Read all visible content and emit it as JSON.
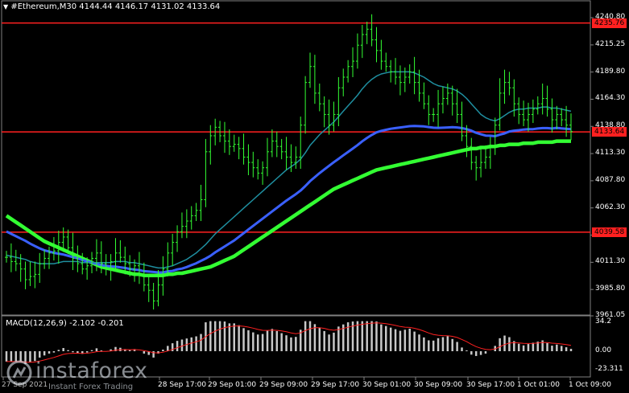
{
  "header": {
    "symbol_info": "#Ethereum,M30  4144.44 4146.17 4131.02 4133.64"
  },
  "price_axis": {
    "labels": [
      "4240.80",
      "4215.25",
      "4189.80",
      "4164.30",
      "4138.80",
      "4113.30",
      "4087.80",
      "4062.30",
      "4036.80",
      "4011.30",
      "3985.80",
      "3961.05"
    ],
    "tags": [
      {
        "text": "4235.76",
        "color": "#ff2020"
      },
      {
        "text": "4133.64",
        "color": "#ff2020"
      },
      {
        "text": "4039.58",
        "color": "#ff2020"
      }
    ]
  },
  "macd": {
    "label": "MACD(12,26,9) -2.102 -0.201",
    "axis_labels": [
      "34.2",
      "0.00",
      "-23.311"
    ]
  },
  "time_axis": {
    "labels": [
      "27 Sep 2021",
      "28 Sep 17:00",
      "29 Sep 01:00",
      "29 Sep 09:00",
      "29 Sep 17:00",
      "30 Sep 01:00",
      "30 Sep 09:00",
      "30 Sep 17:00",
      "1 Oct 01:00",
      "1 Oct 09:00"
    ]
  },
  "watermark": {
    "name": "instaforex",
    "tagline": "Instant Forex Trading"
  },
  "chart_data": {
    "type": "line",
    "symbol": "#Ethereum",
    "timeframe": "M30",
    "ylim": [
      3961.05,
      4240.8
    ],
    "horizontal_levels": [
      4235.76,
      4133.64,
      4039.58
    ],
    "colors": {
      "candle": "#33ff33",
      "ma_fast": "#1f8fa0",
      "ma_mid": "#3a60ff",
      "ma_slow": "#33ff33",
      "level": "#ff2020",
      "macd_hist": "#c8c8c8",
      "macd_signal": "#ff2020"
    },
    "close": [
      4016,
      4012,
      4010,
      4005,
      3995,
      3998,
      4000,
      4010,
      4015,
      4020,
      4022,
      4030,
      4035,
      4025,
      4015,
      4010,
      4005,
      4008,
      4015,
      4020,
      4010,
      4005,
      4012,
      4020,
      4016,
      4010,
      4005,
      4008,
      4000,
      3990,
      3985,
      3975,
      3990,
      4005,
      4020,
      4030,
      4040,
      4045,
      4050,
      4055,
      4060,
      4070,
      4115,
      4130,
      4138,
      4130,
      4125,
      4120,
      4122,
      4118,
      4110,
      4105,
      4100,
      4095,
      4100,
      4115,
      4125,
      4120,
      4115,
      4110,
      4105,
      4110,
      4140,
      4180,
      4195,
      4170,
      4160,
      4150,
      4140,
      4150,
      4175,
      4185,
      4195,
      4200,
      4215,
      4225,
      4230,
      4220,
      4210,
      4200,
      4195,
      4190,
      4185,
      4180,
      4185,
      4190,
      4180,
      4170,
      4160,
      4150,
      4150,
      4160,
      4165,
      4170,
      4160,
      4150,
      4130,
      4120,
      4105,
      4100,
      4105,
      4110,
      4120,
      4140,
      4170,
      4180,
      4175,
      4160,
      4150,
      4145,
      4150,
      4155,
      4160,
      4165,
      4155,
      4145,
      4150,
      4145,
      4140,
      4134
    ],
    "ma_fast": [
      4018,
      4017,
      4016,
      4015,
      4014,
      4012,
      4011,
      4010,
      4010,
      4010,
      4010,
      4011,
      4012,
      4012,
      4012,
      4012,
      4011,
      4011,
      4011,
      4011,
      4011,
      4011,
      4011,
      4012,
      4012,
      4012,
      4011,
      4011,
      4010,
      4009,
      4008,
      4007,
      4006,
      4006,
      4007,
      4008,
      4010,
      4012,
      4014,
      4017,
      4020,
      4024,
      4028,
      4033,
      4038,
      4042,
      4046,
      4050,
      4054,
      4058,
      4062,
      4066,
      4070,
      4074,
      4078,
      4082,
      4086,
      4090,
      4094,
      4098,
      4101,
      4104,
      4108,
      4114,
      4121,
      4126,
      4131,
      4135,
      4139,
      4143,
      4148,
      4153,
      4158,
      4163,
      4168,
      4174,
      4179,
      4183,
      4186,
      4188,
      4189,
      4190,
      4190,
      4190,
      4190,
      4190,
      4189,
      4187,
      4185,
      4182,
      4179,
      4177,
      4176,
      4175,
      4174,
      4172,
      4169,
      4165,
      4160,
      4155,
      4150,
      4147,
      4145,
      4144,
      4146,
      4149,
      4152,
      4154,
      4155,
      4155,
      4156,
      4156,
      4156,
      4157,
      4157,
      4156,
      4156,
      4155,
      4154,
      4153
    ],
    "ma_slow": [
      4055,
      4052,
      4049,
      4046,
      4043,
      4040,
      4037,
      4034,
      4031,
      4029,
      4027,
      4025,
      4023,
      4021,
      4019,
      4017,
      4015,
      4013,
      4011,
      4009,
      4007,
      4006,
      4005,
      4004,
      4003,
      4002,
      4001,
      4000,
      4000,
      3999,
      3999,
      3999,
      3999,
      3999,
      4000,
      4000,
      4001,
      4001,
      4002,
      4003,
      4004,
      4005,
      4006,
      4007,
      4009,
      4011,
      4013,
      4015,
      4017,
      4020,
      4023,
      4026,
      4029,
      4032,
      4035,
      4038,
      4041,
      4044,
      4047,
      4050,
      4053,
      4056,
      4059,
      4062,
      4065,
      4068,
      4071,
      4074,
      4077,
      4080,
      4082,
      4084,
      4086,
      4088,
      4090,
      4092,
      4094,
      4096,
      4098,
      4099,
      4100,
      4101,
      4102,
      4103,
      4104,
      4105,
      4106,
      4107,
      4108,
      4109,
      4110,
      4111,
      4112,
      4113,
      4114,
      4115,
      4116,
      4117,
      4118,
      4118,
      4119,
      4119,
      4120,
      4120,
      4121,
      4121,
      4122,
      4122,
      4122,
      4123,
      4123,
      4123,
      4124,
      4124,
      4124,
      4124,
      4125,
      4125,
      4125,
      4125
    ]
  }
}
